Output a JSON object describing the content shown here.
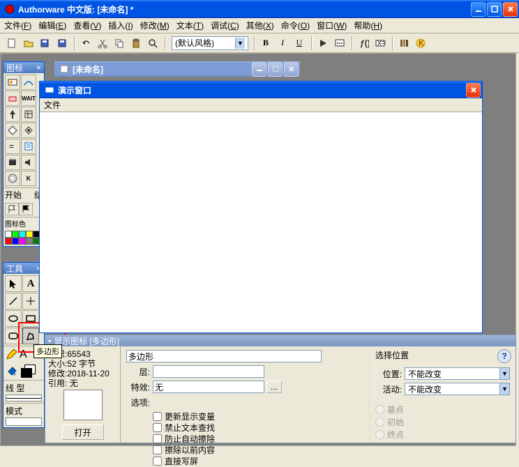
{
  "app": {
    "title": "Authorware 中文版: [未命名] *",
    "menus": [
      {
        "label": "文件",
        "key": "F"
      },
      {
        "label": "编辑",
        "key": "E"
      },
      {
        "label": "查看",
        "key": "V"
      },
      {
        "label": "插入",
        "key": "I"
      },
      {
        "label": "修改",
        "key": "M"
      },
      {
        "label": "文本",
        "key": "T"
      },
      {
        "label": "调试",
        "key": "C"
      },
      {
        "label": "其他",
        "key": "X"
      },
      {
        "label": "命令",
        "key": "O"
      },
      {
        "label": "窗口",
        "key": "W"
      },
      {
        "label": "帮助",
        "key": "H"
      }
    ],
    "style_default": "(默认风格)"
  },
  "toolbar": {
    "icons": [
      "new",
      "open",
      "save-all",
      "save",
      "undo",
      "cut",
      "copy",
      "paste",
      "find"
    ],
    "format_btns": [
      "B",
      "I",
      "U"
    ],
    "run_icons": [
      "play",
      "record",
      "func",
      "var",
      "lib",
      "knowledge"
    ]
  },
  "icon_palette": {
    "title": "图标",
    "section_start": "开始",
    "section_end": "结",
    "color_label": "图标色"
  },
  "tool_palette": {
    "title": "工具",
    "tools": [
      "pointer",
      "text",
      "line-diag",
      "line-plus",
      "oval",
      "rect",
      "round-rect",
      "polygon"
    ],
    "line_label": "线 型",
    "mode_label": "模式",
    "tooltip": "多边形"
  },
  "doc_window": {
    "title": "[未命名]"
  },
  "presentation": {
    "title": "演示窗口",
    "menu_file": "文件"
  },
  "props": {
    "header": "显示图标 [多边形]",
    "id_label": "标识",
    "id_value": "65543",
    "size_label": "大小",
    "size_value": "52 字节",
    "mod_label": "修改",
    "mod_value": "2018-11-20",
    "ref_label": "引用",
    "ref_value": "无",
    "open_btn": "打开",
    "name_value": "多边形",
    "layer_label": "层:",
    "effect_label": "特效:",
    "effect_value": "无",
    "options_label": "选项:",
    "opt1": "更新显示变量",
    "opt2": "禁止文本查找",
    "opt3": "防止自动擦除",
    "opt4": "擦除以前内容",
    "opt5": "直接写屏",
    "pos_section": "选择位置",
    "pos_label": "位置:",
    "pos_value": "不能改变",
    "active_label": "活动:",
    "active_value": "不能改变",
    "r1": "基点",
    "r2": "初始",
    "r3": "终点",
    "help": "?"
  },
  "colors": [
    "#ffffff",
    "#00ff00",
    "#00ffff",
    "#ffff00",
    "#000000",
    "#ff0000",
    "#0000ff",
    "#ff00ff",
    "#808080",
    "#008000"
  ]
}
